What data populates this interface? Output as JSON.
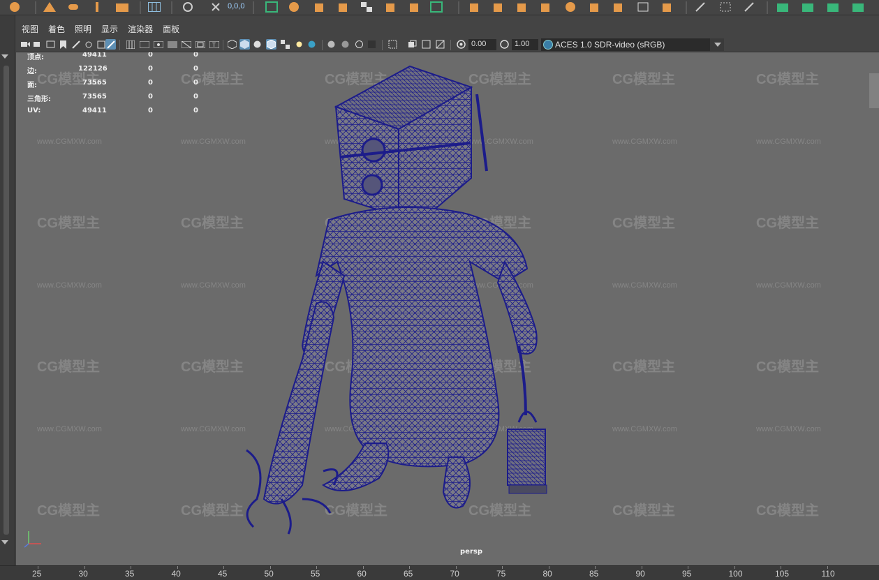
{
  "panel_menu": [
    "视图",
    "着色",
    "照明",
    "显示",
    "渲染器",
    "面板"
  ],
  "shelf": {
    "coord_readout": "0,0,0"
  },
  "toolbar": {
    "exposure": "0.00",
    "gamma": "1.00",
    "color_space": "ACES 1.0 SDR-video (sRGB)"
  },
  "hud": {
    "rows": [
      {
        "label": "顶点:",
        "total": "49411",
        "sel": "0",
        "comp": "0"
      },
      {
        "label": "边:",
        "total": "122126",
        "sel": "0",
        "comp": "0"
      },
      {
        "label": "面:",
        "total": "73565",
        "sel": "0",
        "comp": "0"
      },
      {
        "label": "三角形:",
        "total": "73565",
        "sel": "0",
        "comp": "0"
      },
      {
        "label": "UV:",
        "total": "49411",
        "sel": "0",
        "comp": "0"
      }
    ]
  },
  "viewport": {
    "camera_label": "persp",
    "watermark_logo": "CG模型主",
    "watermark_url": "www.CGMXW.com"
  },
  "timeline": {
    "ticks": [
      "25",
      "30",
      "35",
      "40",
      "45",
      "50",
      "55",
      "60",
      "65",
      "70",
      "75",
      "80",
      "85",
      "90",
      "95",
      "100",
      "105",
      "110"
    ]
  },
  "colors": {
    "viewport_bg": "#6b6b6b",
    "wireframe": "#1c1c8a",
    "active_icon": "#5d8fb4",
    "shelf_orange": "#e59a4a",
    "shelf_green": "#39b77a"
  }
}
